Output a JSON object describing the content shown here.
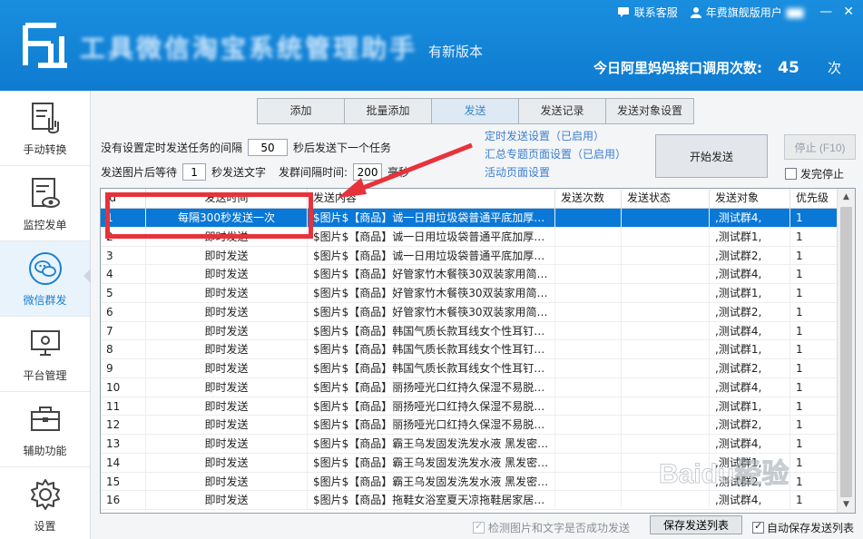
{
  "header": {
    "app_title": "工具微信淘宝系统管理助手",
    "new_version": "有新版本",
    "contact_service": "联系客服",
    "user_label": "年费旗舰版用户",
    "api_count_label": "今日阿里妈妈接口调用次数:",
    "api_count_value": "45",
    "api_count_unit": "次",
    "minimize": "—",
    "close": "✕"
  },
  "sidebar": {
    "items": [
      {
        "label": "手动转换",
        "icon": "manual-convert-icon"
      },
      {
        "label": "监控发单",
        "icon": "monitor-icon"
      },
      {
        "label": "微信群发",
        "icon": "wechat-icon",
        "active": true
      },
      {
        "label": "平台管理",
        "icon": "platform-icon"
      },
      {
        "label": "辅助功能",
        "icon": "toolbox-icon"
      },
      {
        "label": "设置",
        "icon": "gear-icon"
      }
    ]
  },
  "tabs": [
    "添加",
    "批量添加",
    "发送",
    "发送记录",
    "发送对象设置"
  ],
  "settings": {
    "interval_prefix": "没有设置定时发送任务的间隔",
    "interval_value": "50",
    "interval_suffix": "秒后发送下一个任务",
    "image_wait_prefix": "发送图片后等待",
    "image_wait_value": "1",
    "image_wait_suffix": "秒发送文字",
    "group_interval_label": "发群间隔时间:",
    "group_interval_value": "200",
    "group_interval_unit": "毫秒"
  },
  "links": {
    "scheduled": "定时发送设置（已启用）",
    "summary": "汇总专题页面设置（已启用）",
    "activity": "活动页面设置"
  },
  "buttons": {
    "start": "开始发送",
    "stop": "停止 (F10)",
    "stop_after_send": "发完停止",
    "save_list": "保存发送列表"
  },
  "grid": {
    "columns": [
      "id",
      "发送时间",
      "发送内容",
      "发送次数",
      "发送状态",
      "发送对象",
      "优先级"
    ],
    "rows": [
      [
        "1",
        "每隔300秒发送一次",
        "$图片$【商品】诚一日用垃圾袋普通平底加厚…",
        "",
        "",
        ",测试群4,",
        "1"
      ],
      [
        "2",
        "即时发送",
        "$图片$【商品】诚一日用垃圾袋普通平底加厚…",
        "",
        "",
        ",测试群1,",
        "1"
      ],
      [
        "3",
        "即时发送",
        "$图片$【商品】诚一日用垃圾袋普通平底加厚…",
        "",
        "",
        ",测试群2,",
        "1"
      ],
      [
        "4",
        "即时发送",
        "$图片$【商品】好管家竹木餐筷30双装家用简…",
        "",
        "",
        ",测试群4,",
        "1"
      ],
      [
        "5",
        "即时发送",
        "$图片$【商品】好管家竹木餐筷30双装家用简…",
        "",
        "",
        ",测试群1,",
        "1"
      ],
      [
        "6",
        "即时发送",
        "$图片$【商品】好管家竹木餐筷30双装家用简…",
        "",
        "",
        ",测试群2,",
        "1"
      ],
      [
        "7",
        "即时发送",
        "$图片$【商品】韩国气质长款耳线女个性耳钉…",
        "",
        "",
        ",测试群4,",
        "1"
      ],
      [
        "8",
        "即时发送",
        "$图片$【商品】韩国气质长款耳线女个性耳钉…",
        "",
        "",
        ",测试群1,",
        "1"
      ],
      [
        "9",
        "即时发送",
        "$图片$【商品】韩国气质长款耳线女个性耳钉…",
        "",
        "",
        ",测试群2,",
        "1"
      ],
      [
        "10",
        "即时发送",
        "$图片$【商品】丽扬哑光口红持久保湿不易脱…",
        "",
        "",
        ",测试群4,",
        "1"
      ],
      [
        "11",
        "即时发送",
        "$图片$【商品】丽扬哑光口红持久保湿不易脱…",
        "",
        "",
        ",测试群1,",
        "1"
      ],
      [
        "12",
        "即时发送",
        "$图片$【商品】丽扬哑光口红持久保湿不易脱…",
        "",
        "",
        ",测试群2,",
        "1"
      ],
      [
        "13",
        "即时发送",
        "$图片$【商品】霸王乌发固发洗发水液 黑发密…",
        "",
        "",
        ",测试群4,",
        "1"
      ],
      [
        "14",
        "即时发送",
        "$图片$【商品】霸王乌发固发洗发水液 黑发密…",
        "",
        "",
        ",测试群1,",
        "1"
      ],
      [
        "15",
        "即时发送",
        "$图片$【商品】霸王乌发固发洗发水液 黑发密…",
        "",
        "",
        ",测试群2,",
        "1"
      ],
      [
        "16",
        "即时发送",
        "$图片$【商品】拖鞋女浴室夏天凉拖鞋居家居…",
        "",
        "",
        ",测试群4,",
        "1"
      ]
    ]
  },
  "bottom": {
    "check_image_text": "检测图片和文字是否成功发送",
    "auto_save": "自动保存发送列表"
  },
  "watermark": "Baidu经验",
  "colors": {
    "header_blue": "#0e7bd0",
    "selected_row": "#0a78d7",
    "annotation_red": "#e8323a",
    "link_blue": "#3d7fd0"
  }
}
